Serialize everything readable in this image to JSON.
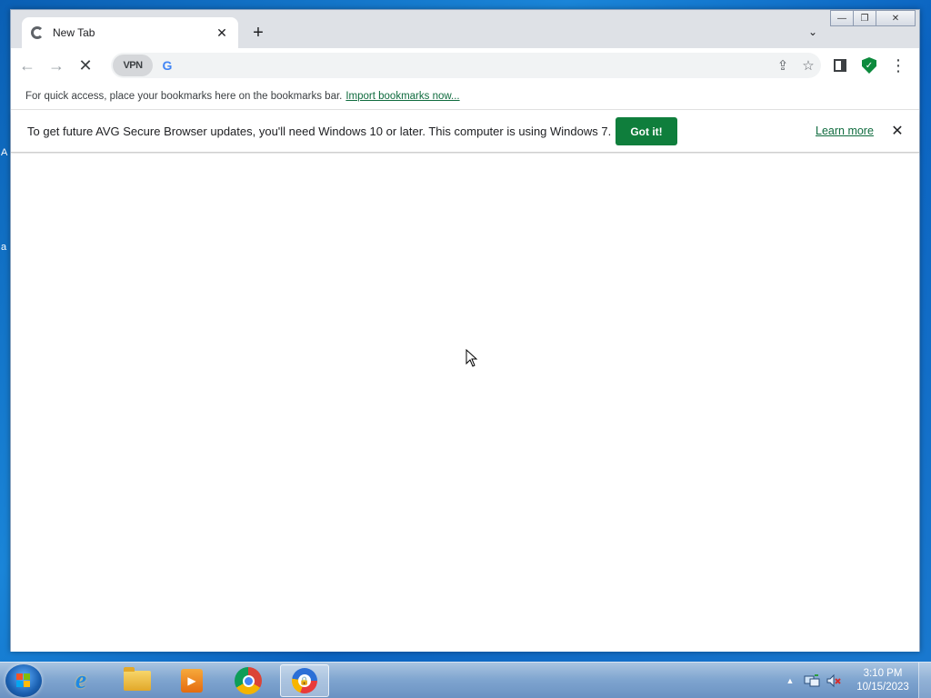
{
  "desktop": {
    "edge_text_1": "A",
    "edge_text_2": "a"
  },
  "browser": {
    "tab": {
      "title": "New Tab",
      "close_glyph": "✕"
    },
    "new_tab_glyph": "+",
    "tab_search_glyph": "⌄",
    "window_controls": {
      "minimize": "—",
      "maximize": "❐",
      "close": "✕"
    },
    "toolbar": {
      "back_glyph": "←",
      "forward_glyph": "→",
      "stop_glyph": "✕",
      "vpn_label": "VPN",
      "search_engine_glyph": "G",
      "address_value": "",
      "address_placeholder": "",
      "share_glyph": "⇪",
      "bookmark_glyph": "☆",
      "shield_glyph": "✓",
      "menu_glyph": "⋮"
    },
    "bookmarks_bar": {
      "text": "For quick access, place your bookmarks here on the bookmarks bar.",
      "link": "Import bookmarks now..."
    },
    "infobar": {
      "message": "To get future AVG Secure Browser updates, you'll need Windows 10 or later. This computer is using Windows 7.",
      "button": "Got it!",
      "learn_more": "Learn more",
      "close_glyph": "✕"
    }
  },
  "taskbar": {
    "apps": [
      {
        "name": "Internet Explorer",
        "icon": "internet-explorer-icon"
      },
      {
        "name": "File Explorer",
        "icon": "folder-icon"
      },
      {
        "name": "Windows Media Player",
        "icon": "media-player-icon"
      },
      {
        "name": "Google Chrome",
        "icon": "chrome-icon"
      },
      {
        "name": "AVG Secure Browser",
        "icon": "avg-browser-icon",
        "active": true
      }
    ],
    "tray": {
      "show_hidden_glyph": "▲",
      "time": "3:10 PM",
      "date": "10/15/2023"
    }
  },
  "colors": {
    "accent_green": "#0f7e3c",
    "link_green": "#0f6b3e",
    "tabstrip": "#dee1e6"
  }
}
